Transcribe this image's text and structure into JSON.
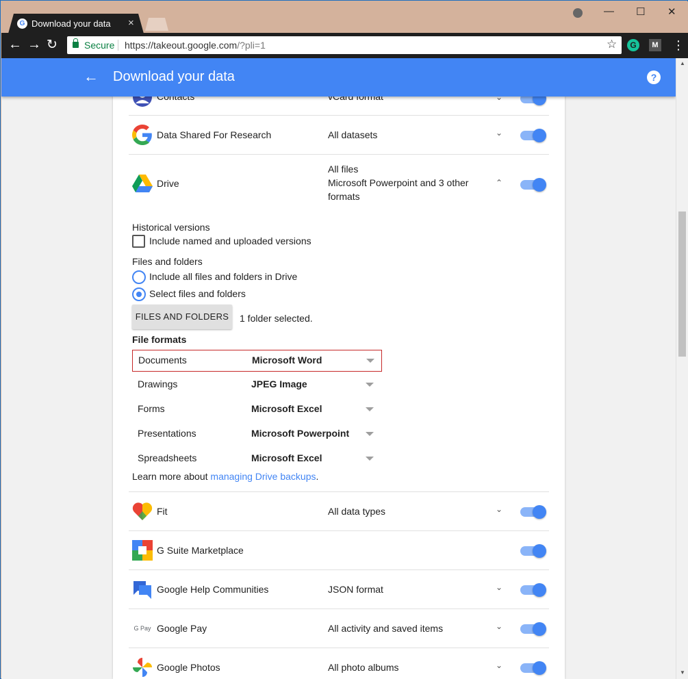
{
  "browser": {
    "tab_title": "Download your data",
    "tab_favicon": "G",
    "tab_close": "×",
    "secure_label": "Secure",
    "url_main": "https://takeout.google.com",
    "url_rest": "/?pli=1",
    "window_minimize": "—",
    "window_maximize": "☐",
    "window_close": "✕",
    "ext_g": "G",
    "ext_m": "M"
  },
  "appbar": {
    "title": "Download your data",
    "help": "?"
  },
  "products": [
    {
      "name": "Contacts",
      "format": "vCard format"
    },
    {
      "name": "Data Shared For Research",
      "format": "All datasets"
    },
    {
      "name": "Drive",
      "format_lines": [
        "All files",
        "Microsoft Powerpoint and 3 other",
        "formats"
      ]
    },
    {
      "name": "Fit",
      "format": "All data types"
    },
    {
      "name": "G Suite Marketplace",
      "format": ""
    },
    {
      "name": "Google Help Communities",
      "format": "JSON format"
    },
    {
      "name": "Google Pay",
      "format": "All activity and saved items"
    },
    {
      "name": "Google Photos",
      "format": "All photo albums"
    }
  ],
  "drive_options": {
    "historical_label": "Historical versions",
    "include_named": "Include named and uploaded versions",
    "files_folders_label": "Files and folders",
    "include_all": "Include all files and folders in Drive",
    "select_files": "Select files and folders",
    "button": "FILES AND FOLDERS",
    "folder_selected": "1 folder selected.",
    "file_formats_heading": "File formats",
    "formats": [
      {
        "type": "Documents",
        "value": "Microsoft Word"
      },
      {
        "type": "Drawings",
        "value": "JPEG Image"
      },
      {
        "type": "Forms",
        "value": "Microsoft Excel"
      },
      {
        "type": "Presentations",
        "value": "Microsoft Powerpoint"
      },
      {
        "type": "Spreadsheets",
        "value": "Microsoft Excel"
      }
    ],
    "learn_prefix": "Learn more about ",
    "learn_link": "managing Drive backups",
    "learn_suffix": "."
  },
  "gpay_icon_text": "G Pay"
}
